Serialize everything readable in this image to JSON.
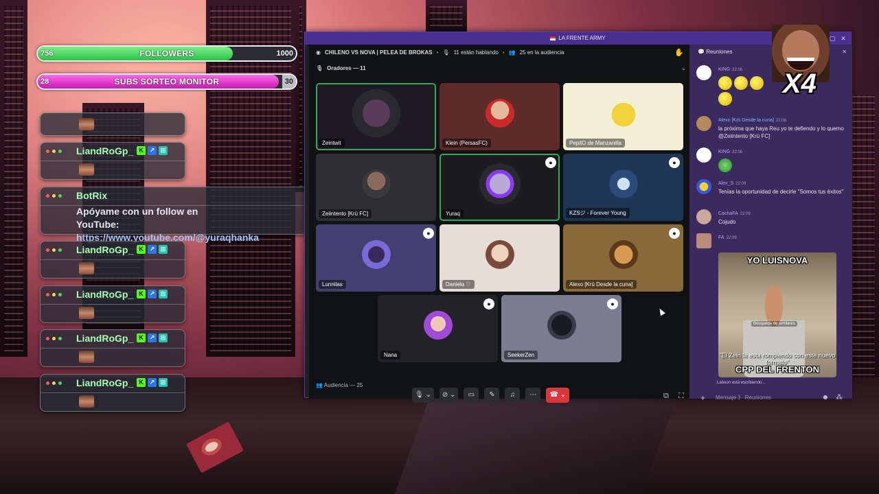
{
  "overlay": {
    "followers_bar": {
      "current": "756",
      "label": "FOLLOWERS",
      "goal": "1000",
      "progress": 0.756,
      "color": "#2fbf4a"
    },
    "subs_bar": {
      "current": "28",
      "label": "SUBS SORTEO MONITOR",
      "goal": "30",
      "progress": 0.933,
      "color": "#c719b4"
    },
    "chat_cards": [
      {
        "author": "LiandRoGp_"
      },
      {
        "author": "LiandRoGp_"
      },
      {
        "author": "LiandRoGp_"
      },
      {
        "author": "LiandRoGp_"
      },
      {
        "author": "LiandRoGp_"
      }
    ],
    "botrix": {
      "author": "BotRix",
      "line1": "Apóyame con un follow en YouTube:",
      "line2": "https://www.youtube.com/@yuraqhanka"
    },
    "meme_overlay_text": "X4"
  },
  "window": {
    "title": "LA FRENTE ARMY",
    "stage": {
      "event_title": "CHILENO VS NOVA | PELEA DE BROKAS",
      "speaking_count": "11 están hablando",
      "audience_count": "25 en la audiencia",
      "speakers_header": "Oradores — 11",
      "audience_header": "Audiencia — 25"
    },
    "tiles": [
      {
        "name": "Zeintwit",
        "avatar_color": "#3a2d3a"
      },
      {
        "name": "Klein (PersasFC)",
        "avatar_color": "#c07a66"
      },
      {
        "name": "PepitO de Manzanilla",
        "avatar_color": "#f0d23a"
      },
      {
        "name": "Zeiintento [Krū FC]",
        "avatar_color": "#6b6b6b"
      },
      {
        "name": "Yuraq",
        "avatar_color": "#7a5ab0"
      },
      {
        "name": "KZSジ - Forever Young",
        "avatar_color": "#4e6d92"
      },
      {
        "name": "Lunnilas",
        "avatar_color": "#5a4a8a"
      },
      {
        "name": "Daniela ♡",
        "avatar_color": "#c9a79b"
      },
      {
        "name": "Alexo [Krū Desde la cuna]",
        "avatar_color": "#b07a3a"
      },
      {
        "name": "Nana",
        "avatar_color": "#7a4ab0"
      },
      {
        "name": "SeekerZen",
        "avatar_color": "#2a2a34"
      }
    ],
    "chat": {
      "header": "Reuniones",
      "messages": [
        {
          "author": "KING",
          "time": "22:08",
          "text": ""
        },
        {
          "author": "Alexo [Krū Desde la cuna]",
          "time": "22:08",
          "text": "la próxima que haya Reu yo te defiendo y lo quemo @Zeiintento [Krū FC]"
        },
        {
          "author": "KING",
          "time": "22:08",
          "text": ""
        },
        {
          "author": "Alex_S",
          "time": "22:09",
          "text": "Tenías la oportunidad de decirle \"Somos tus éxitos\""
        },
        {
          "author": "CachaFA",
          "time": "22:09",
          "text": "Cojudo"
        },
        {
          "author": "FA",
          "time": "22:09",
          "text": ""
        }
      ],
      "meme": {
        "top": "YO LUISNOVA",
        "search": "Búsqueda de similares",
        "middle": "\"El Zein la esta rompiendo con este nuevo formato\"",
        "bottom": "CPP DEL FRENTON"
      },
      "typing": "Laboon está escribiendo...",
      "compose_placeholder": "Mensaje  》 Reuniones"
    }
  }
}
